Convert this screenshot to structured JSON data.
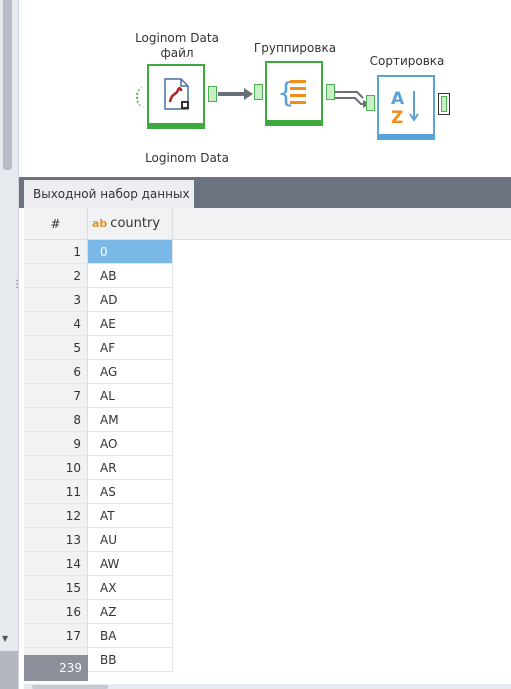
{
  "workflow": {
    "node1": {
      "label_line1": "Loginom Data",
      "label_line2": "файл",
      "color": "#3daa3d"
    },
    "node2": {
      "label": "Группировка",
      "color": "#3daa3d"
    },
    "node3": {
      "label": "Сортировка",
      "color": "#5aa3d9"
    },
    "node4": {
      "label_line1": "Loginom Data"
    }
  },
  "tabs": {
    "active": "Выходной набор данных"
  },
  "table": {
    "header_num": "#",
    "column_type": "ab",
    "column_name": "country",
    "rows": [
      {
        "n": "1",
        "v": "0"
      },
      {
        "n": "2",
        "v": "AB"
      },
      {
        "n": "3",
        "v": "AD"
      },
      {
        "n": "4",
        "v": "AE"
      },
      {
        "n": "5",
        "v": "AF"
      },
      {
        "n": "6",
        "v": "AG"
      },
      {
        "n": "7",
        "v": "AL"
      },
      {
        "n": "8",
        "v": "AM"
      },
      {
        "n": "9",
        "v": "AO"
      },
      {
        "n": "10",
        "v": "AR"
      },
      {
        "n": "11",
        "v": "AS"
      },
      {
        "n": "12",
        "v": "AT"
      },
      {
        "n": "13",
        "v": "AU"
      },
      {
        "n": "14",
        "v": "AW"
      },
      {
        "n": "15",
        "v": "AX"
      },
      {
        "n": "16",
        "v": "AZ"
      },
      {
        "n": "17",
        "v": "BA"
      },
      {
        "n": "",
        "v": "BB"
      }
    ],
    "total_count": "239"
  }
}
